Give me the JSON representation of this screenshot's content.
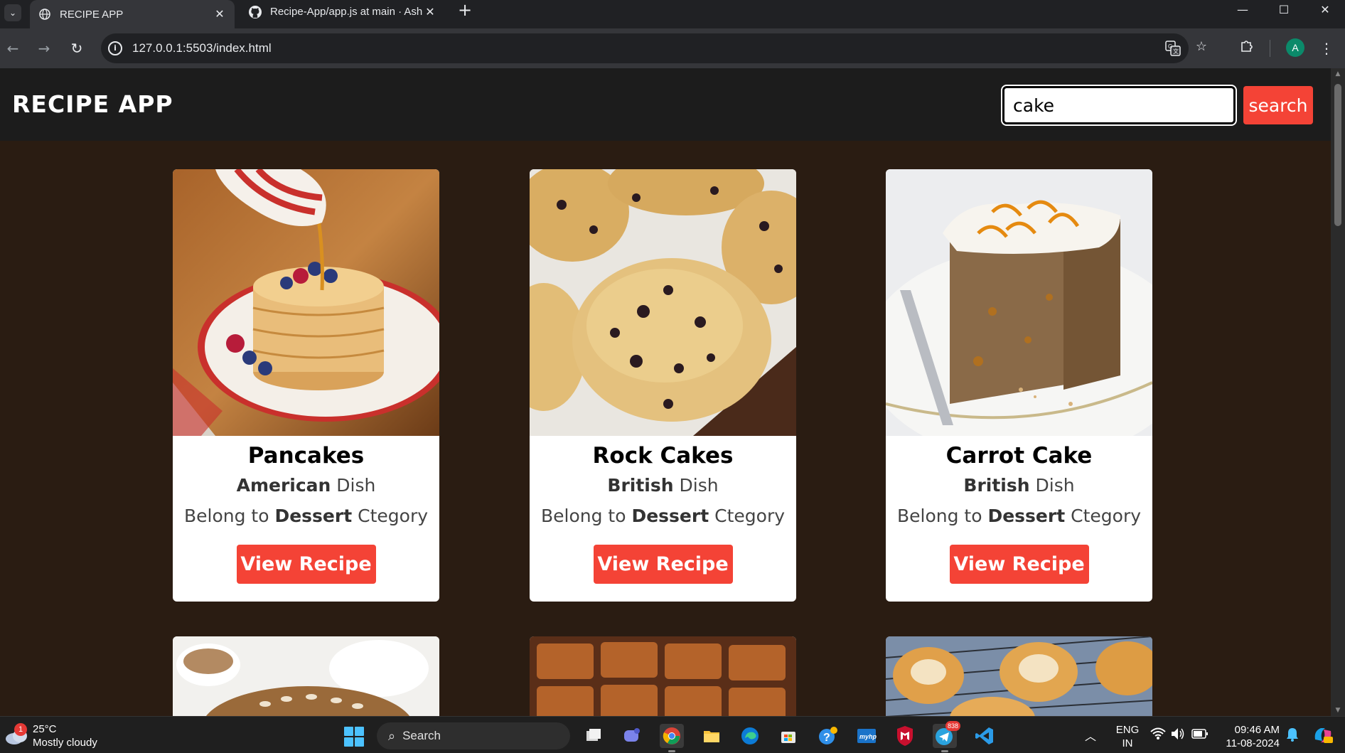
{
  "browser": {
    "tabs": [
      {
        "title": "RECIPE APP",
        "active": true
      },
      {
        "title": "Recipe-App/app.js at main · Ash",
        "active": false
      }
    ],
    "url": "127.0.0.1:5503/index.html",
    "profile_initial": "A"
  },
  "header": {
    "title": "RECIPE APP",
    "search_value": "cake",
    "search_button": "search"
  },
  "recipes": [
    {
      "name": "Pancakes",
      "area": "American",
      "area_suffix": " Dish",
      "cat_prefix": "Belong to ",
      "category": "Dessert",
      "cat_suffix": " Ctegory",
      "button": "View Recipe"
    },
    {
      "name": "Rock Cakes",
      "area": "British",
      "area_suffix": " Dish",
      "cat_prefix": "Belong to ",
      "category": "Dessert",
      "cat_suffix": " Ctegory",
      "button": "View Recipe"
    },
    {
      "name": "Carrot Cake",
      "area": "British",
      "area_suffix": " Dish",
      "cat_prefix": "Belong to ",
      "category": "Dessert",
      "cat_suffix": " Ctegory",
      "button": "View Recipe"
    }
  ],
  "taskbar": {
    "weather_temp": "25°C",
    "weather_desc": "Mostly cloudy",
    "weather_badge": "1",
    "search_label": "Search",
    "telegram_badge": "838",
    "lang_line1": "ENG",
    "lang_line2": "IN",
    "time": "09:46 AM",
    "date": "11-08-2024"
  },
  "colors": {
    "accent": "#f44336",
    "page_bg": "#2a1c12",
    "header_bg": "#1c1c1c"
  }
}
